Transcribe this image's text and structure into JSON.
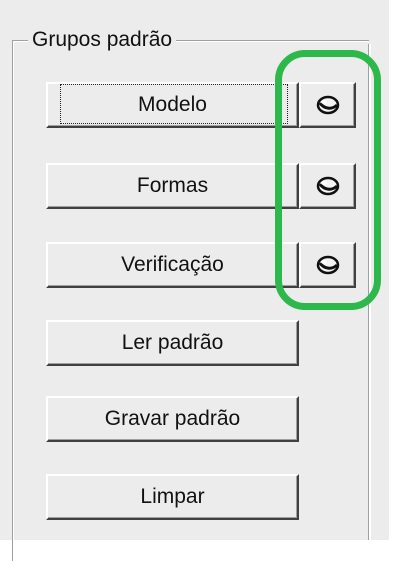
{
  "group": {
    "title": "Grupos padrão"
  },
  "buttons": {
    "modelo": "Modelo",
    "formas": "Formas",
    "verificacao": "Verificação",
    "ler_padrao": "Ler padrão",
    "gravar_padrao": "Gravar padrão",
    "limpar": "Limpar"
  },
  "icons": {
    "small_button_icon": "magic-ball-icon"
  },
  "colors": {
    "highlight": "#2db84b",
    "window_bg": "#ececec"
  }
}
